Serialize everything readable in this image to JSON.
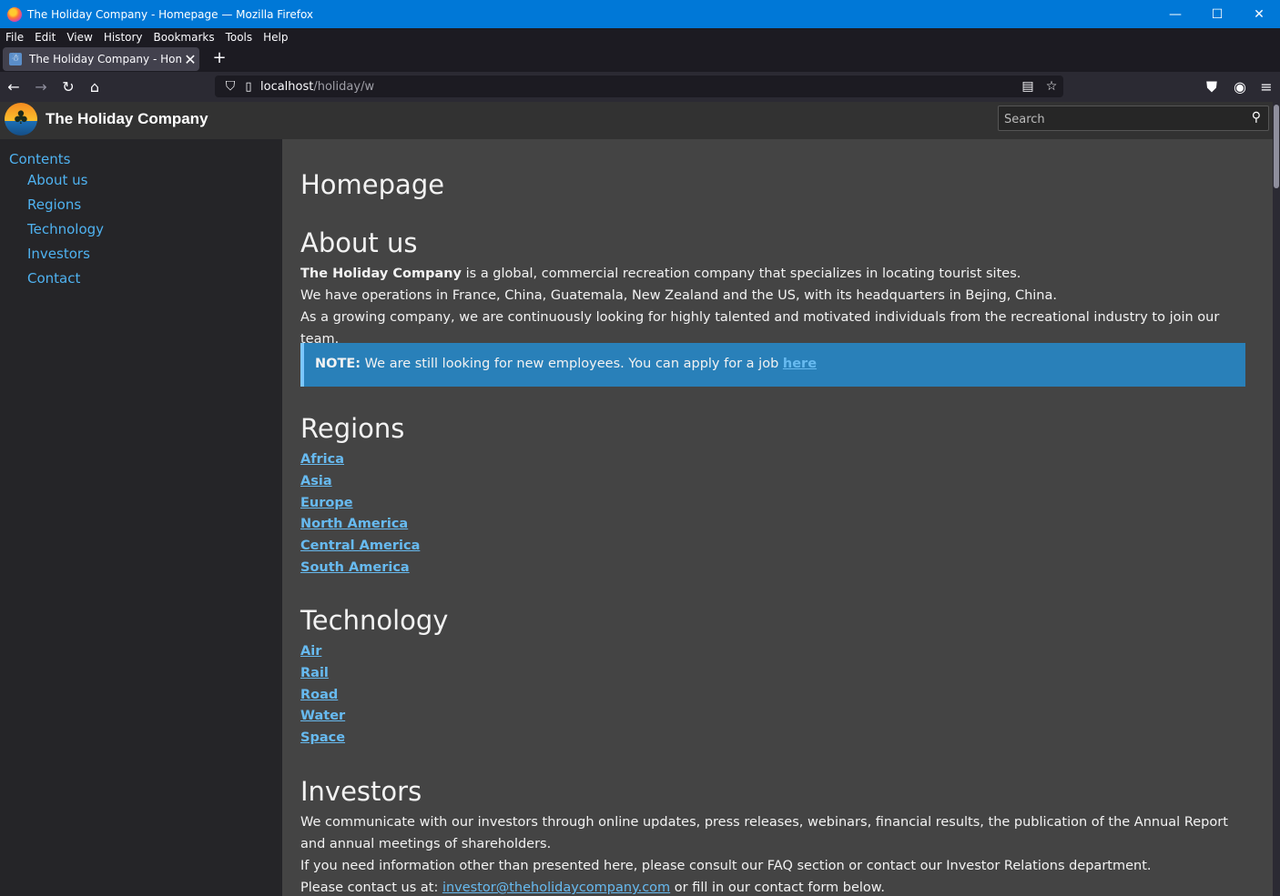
{
  "window": {
    "title": "The Holiday Company - Homepage — Mozilla Firefox",
    "controls": {
      "minimize": "—",
      "maximize": "☐",
      "close": "✕"
    }
  },
  "menu": [
    "File",
    "Edit",
    "View",
    "History",
    "Bookmarks",
    "Tools",
    "Help"
  ],
  "tab": {
    "title": "The Holiday Company - Homepage",
    "close": "✕",
    "new_tab": "+"
  },
  "navigation": {
    "url_host": "localhost",
    "url_path": "/holiday/w",
    "icons": [
      "back-icon",
      "forward-icon",
      "reload-icon",
      "home-icon",
      "shield-icon",
      "page-icon",
      "reader-mode-icon",
      "bookmark-star-icon",
      "pocket-icon",
      "account-icon",
      "menu-icon"
    ]
  },
  "site": {
    "name": "The Holiday Company",
    "search_placeholder": "Search"
  },
  "sidebar": {
    "heading": "Contents",
    "items": [
      "About us",
      "Regions",
      "Technology",
      "Investors",
      "Contact"
    ]
  },
  "content": {
    "page_title": "Homepage",
    "about": {
      "heading": "About us",
      "company_bold": "The Holiday Company",
      "line1_rest": " is a global, commercial recreation company that specializes in locating tourist sites.",
      "line2": "We have operations in France, China, Guatemala, New Zealand and the US, with its headquarters in Bejing, China.",
      "line3": "As a growing company, we are continuously looking for highly talented and motivated individuals from the recreational industry to join our team."
    },
    "note": {
      "label": "NOTE:",
      "text": " We are still looking for new employees. You can apply for a job ",
      "link": "here"
    },
    "regions": {
      "heading": "Regions",
      "links": [
        "Africa",
        "Asia",
        "Europe",
        "North America",
        "Central America",
        "South America"
      ]
    },
    "technology": {
      "heading": "Technology",
      "links": [
        "Air",
        "Rail",
        "Road",
        "Water",
        "Space"
      ]
    },
    "investors": {
      "heading": "Investors",
      "line1": "We communicate with our investors through online updates, press releases, webinars, financial results, the publication of the Annual Report and annual meetings of shareholders.",
      "line2": "If you need information other than presented here, please consult our FAQ section or contact our Investor Relations department.",
      "line3_prefix": "Please contact us at: ",
      "email": "investor@theholidaycompany.com",
      "line3_suffix": " or fill in our contact form below."
    }
  },
  "colors": {
    "titlebar": "#0078d7",
    "link": "#67baf0",
    "note_bg": "#2980b9",
    "content_bg": "#444444",
    "sidebar_bg": "#252528"
  }
}
